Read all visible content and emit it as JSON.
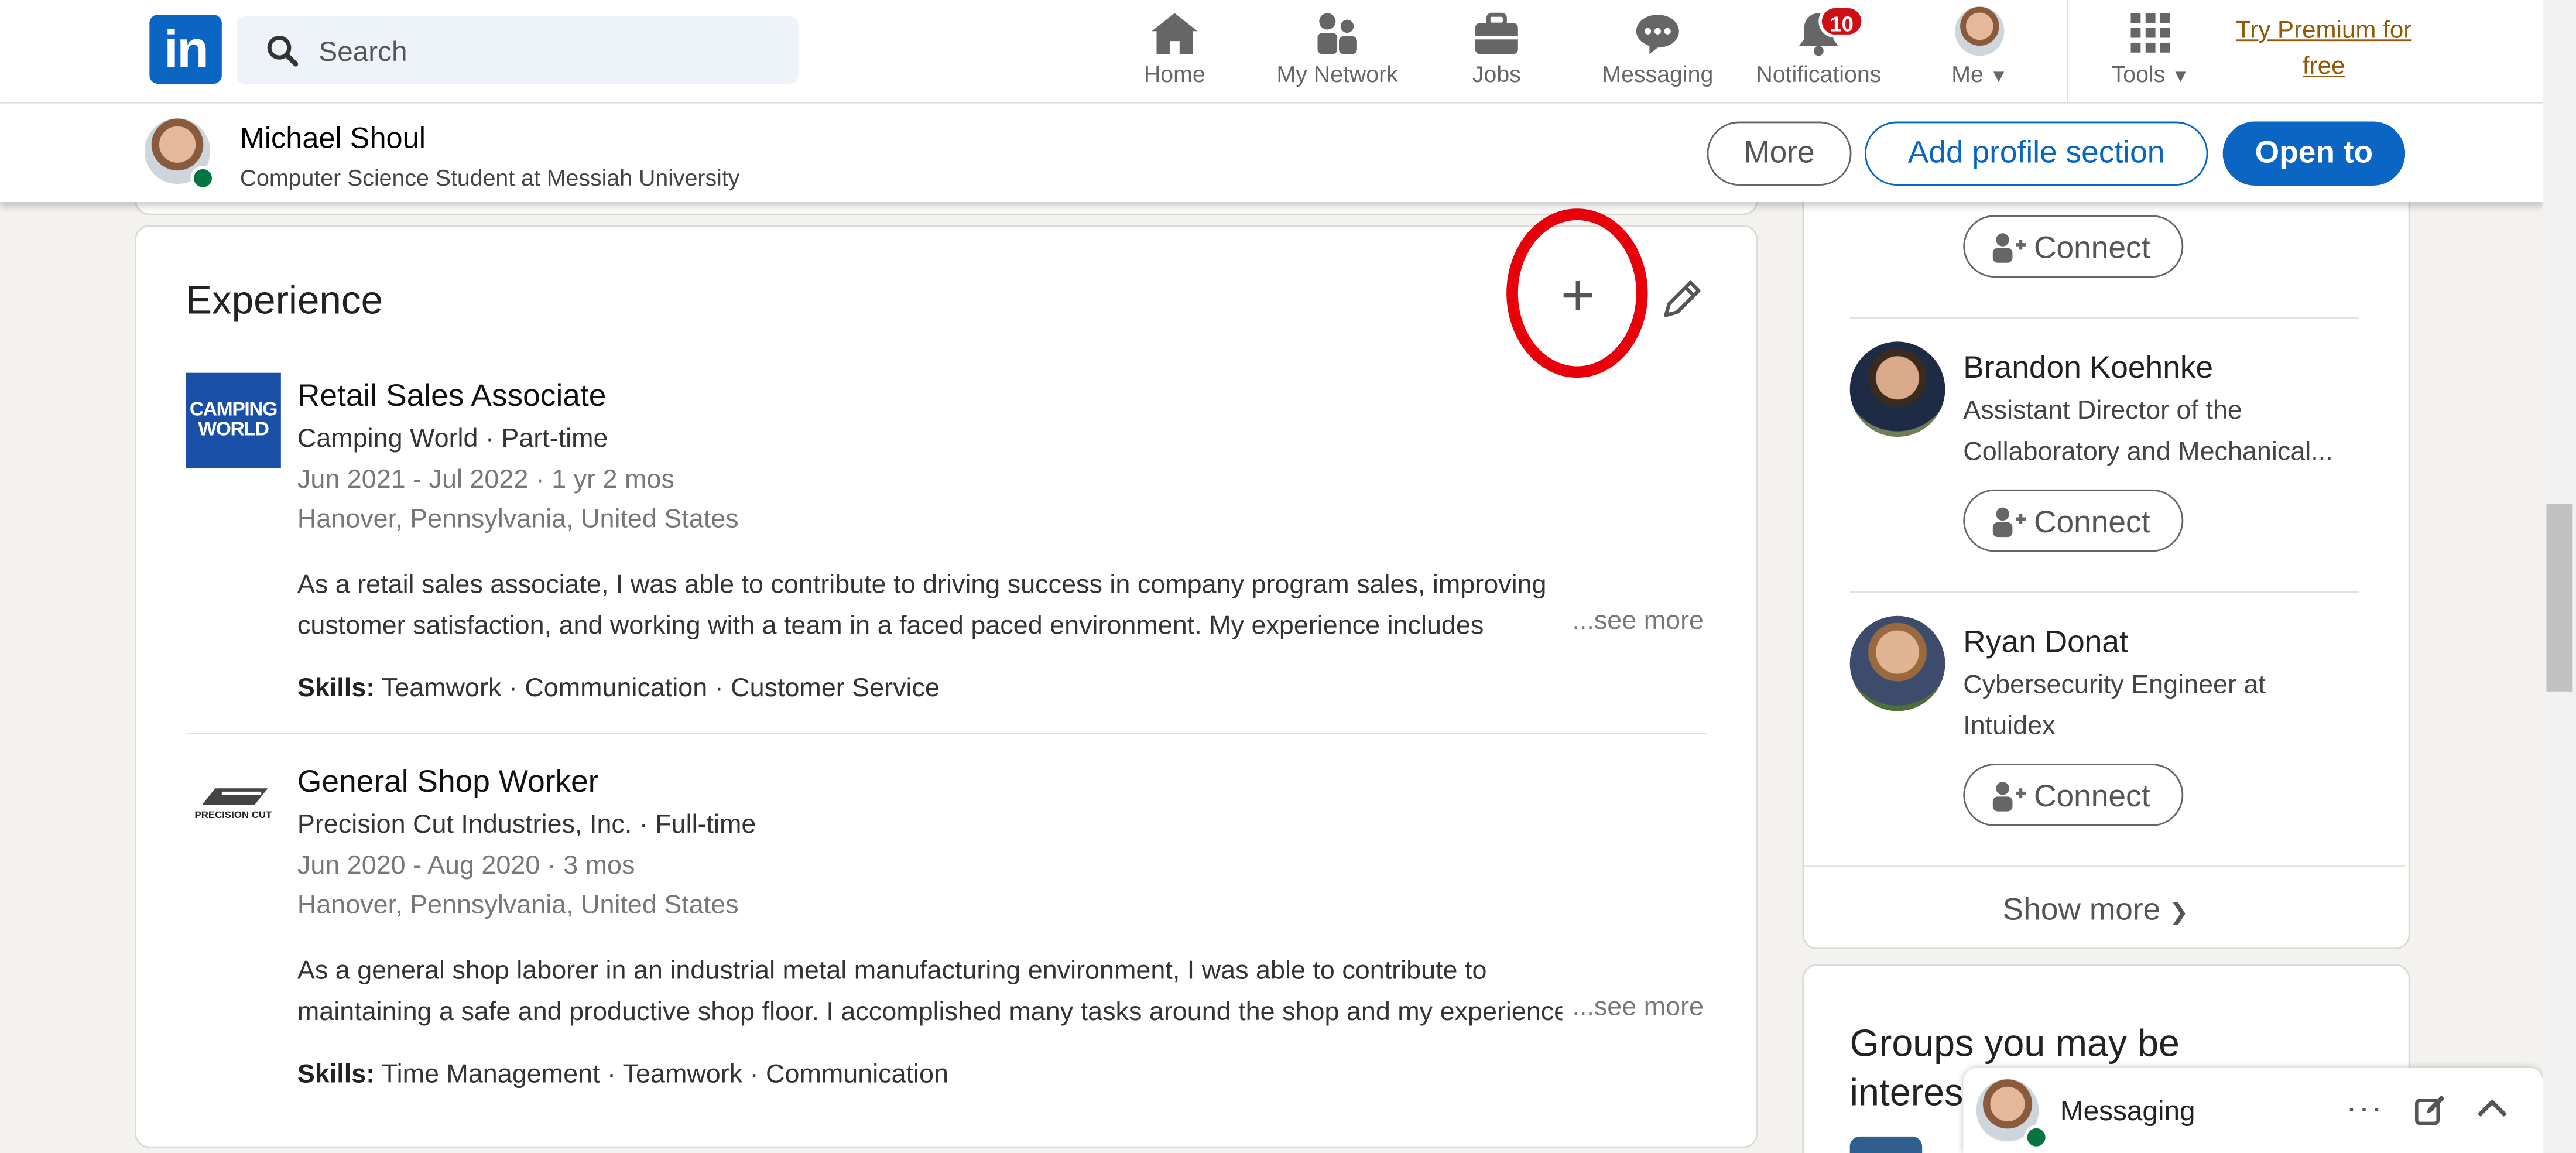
{
  "nav": {
    "search_placeholder": "Search",
    "items": [
      {
        "label": "Home",
        "icon": "home-icon"
      },
      {
        "label": "My Network",
        "icon": "network-icon"
      },
      {
        "label": "Jobs",
        "icon": "briefcase-icon"
      },
      {
        "label": "Messaging",
        "icon": "chat-icon"
      },
      {
        "label": "Notifications",
        "icon": "bell-icon"
      },
      {
        "label": "Me",
        "icon": "avatar"
      },
      {
        "label": "Tools",
        "icon": "grid-icon"
      }
    ],
    "notifications_count": "10",
    "premium_line1": "Try Premium for",
    "premium_line2": "free"
  },
  "profile_bar": {
    "name": "Michael Shoul",
    "headline": "Computer Science Student at Messiah University",
    "more_label": "More",
    "add_section_label": "Add profile section",
    "open_to_label": "Open to"
  },
  "experience": {
    "title": "Experience",
    "items": [
      {
        "logo_text": "CAMPING WORLD",
        "role": "Retail Sales Associate",
        "company": "Camping World · Part-time",
        "dates": "Jun 2021 - Jul 2022 · 1 yr 2 mos",
        "location": "Hanover, Pennsylvania, United States",
        "desc_line1": "As a retail sales associate, I was able to contribute to driving success in company program sales, improving",
        "desc_line2": "customer satisfaction, and working with a team in a faced paced environment. My experience includes",
        "see_more": "...see more",
        "skills_label": "Skills:",
        "skills": "Teamwork · Communication · Customer Service"
      },
      {
        "logo_text": "PRECISION CUT",
        "role": "General Shop Worker",
        "company": "Precision Cut Industries, Inc. · Full-time",
        "dates": "Jun 2020 - Aug 2020 · 3 mos",
        "location": "Hanover, Pennsylvania, United States",
        "desc_line1": "As a general shop laborer in an industrial metal manufacturing environment, I was able to contribute to",
        "desc_line2": "maintaining a safe and productive shop floor. I accomplished many tasks around the shop and my experience",
        "see_more": "...see more",
        "skills_label": "Skills:",
        "skills": "Time Management · Teamwork · Communication"
      }
    ]
  },
  "people": {
    "connect_label": "Connect",
    "list": [
      {
        "name": "Brandon Koehnke",
        "line1": "Assistant Director of the",
        "line2": "Collaboratory and Mechanical..."
      },
      {
        "name": "Ryan Donat",
        "line1": "Cybersecurity Engineer at",
        "line2": "Intuidex"
      }
    ],
    "show_more": "Show more"
  },
  "groups": {
    "title_line1": "Groups you may be",
    "title_line2": "interes"
  },
  "messaging": {
    "label": "Messaging"
  },
  "colors": {
    "brand": "#0a66c2",
    "highlight": "#e8000b",
    "notification": "#cc1016",
    "premium": "#915907"
  }
}
